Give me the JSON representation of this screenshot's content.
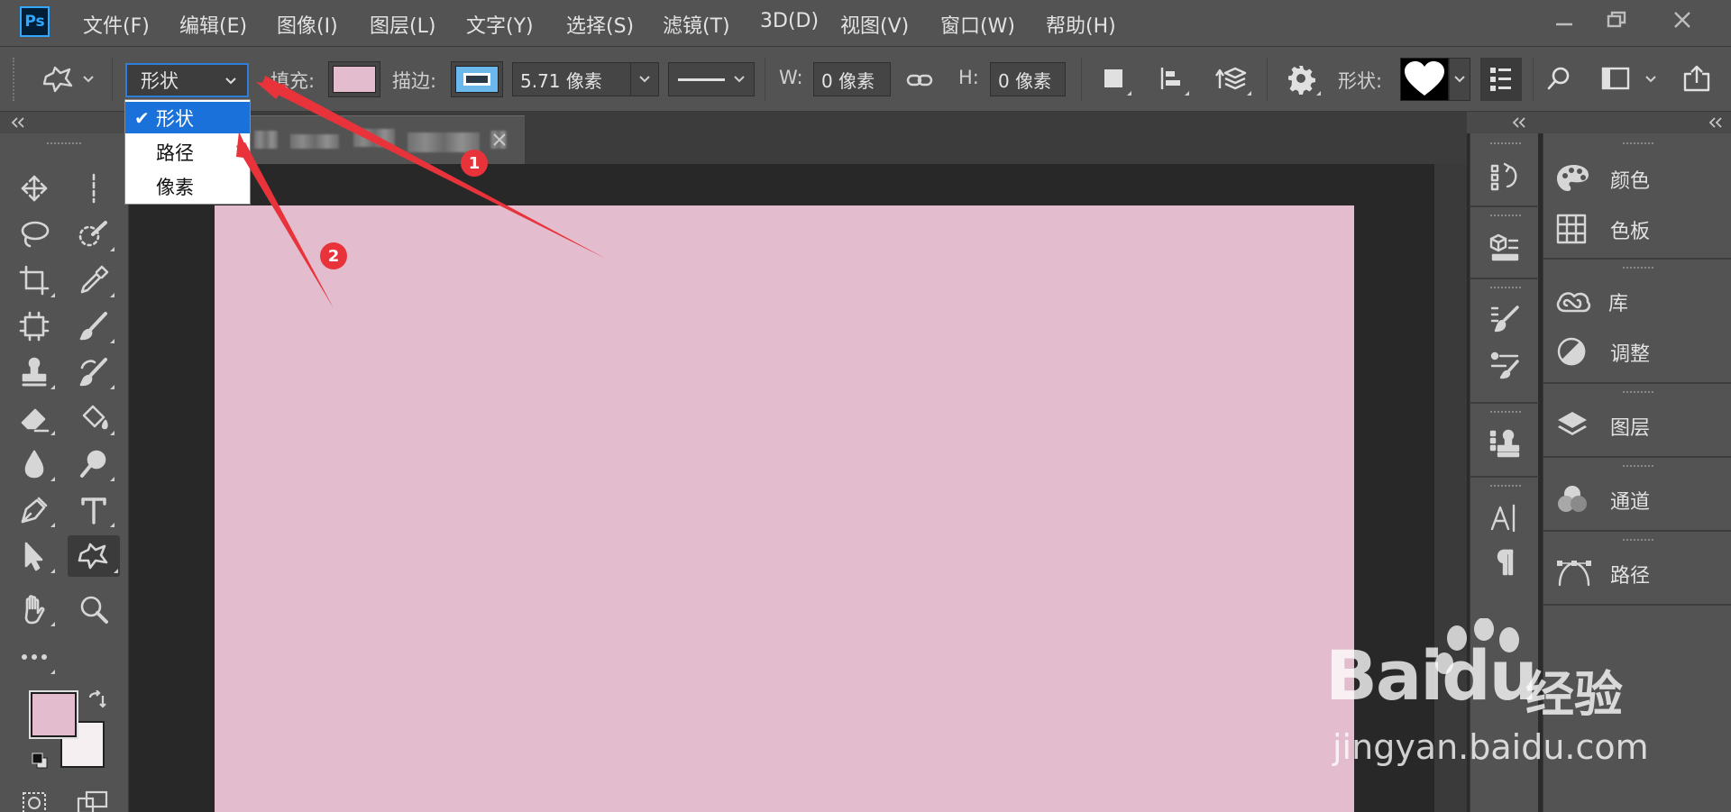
{
  "app": {
    "logo_text": "Ps",
    "accent_color": "#31a8ff",
    "menu": [
      "文件(F)",
      "编辑(E)",
      "图像(I)",
      "图层(L)",
      "文字(Y)",
      "选择(S)",
      "滤镜(T)",
      "3D(D)",
      "视图(V)",
      "窗口(W)",
      "帮助(H)"
    ]
  },
  "options": {
    "mode_selected": "形状",
    "fill_label": "填充:",
    "fill_color": "#e3bccd",
    "stroke_label": "描边:",
    "stroke_width": "5.71 像素",
    "w_label": "W:",
    "w_value": "0 像素",
    "h_label": "H:",
    "h_value": "0 像素",
    "shape_label": "形状:",
    "shape_preset": "heart"
  },
  "mode_dropdown": {
    "options": [
      "形状",
      "路径",
      "像素"
    ],
    "selected_index": 0
  },
  "toolbar": {
    "foreground_color": "#e3bccd",
    "background_color": "#f5eff2"
  },
  "document": {
    "canvas_color": "#e3bccd"
  },
  "panels": [
    "颜色",
    "色板",
    "库",
    "调整",
    "图层",
    "通道",
    "路径"
  ],
  "annotations": [
    "1",
    "2"
  ],
  "watermark": {
    "main": "Baidu",
    "cn": "经验",
    "sub": "jingyan.baidu.com"
  }
}
